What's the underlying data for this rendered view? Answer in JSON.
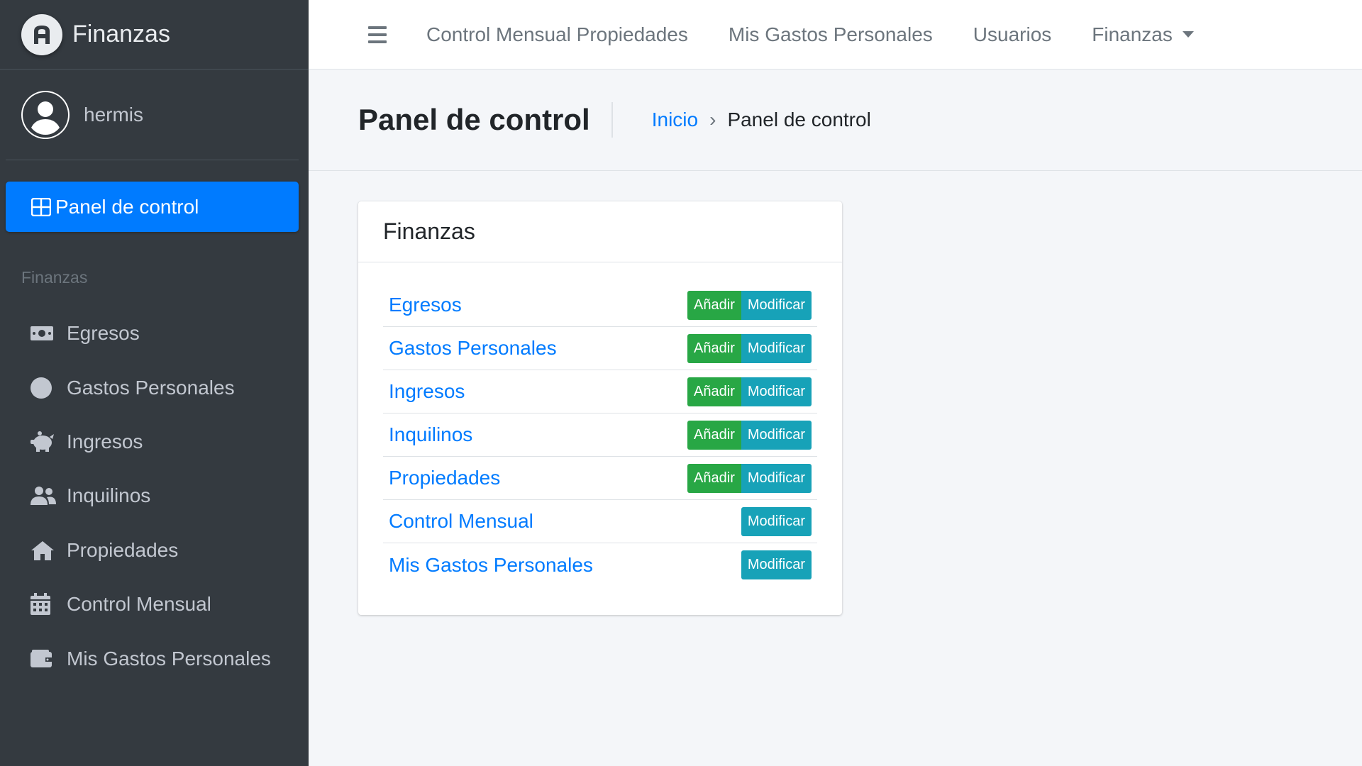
{
  "brand": {
    "name": "Finanzas"
  },
  "user": {
    "name": "hermis"
  },
  "sidebar": {
    "active": {
      "label": "Panel de control",
      "icon": "dashboard-icon"
    },
    "section_header": "Finanzas",
    "items": [
      {
        "label": "Egresos",
        "icon": "money-bill-icon"
      },
      {
        "label": "Gastos Personales",
        "icon": "circle-icon"
      },
      {
        "label": "Ingresos",
        "icon": "piggy-bank-icon"
      },
      {
        "label": "Inquilinos",
        "icon": "users-icon"
      },
      {
        "label": "Propiedades",
        "icon": "home-icon"
      },
      {
        "label": "Control Mensual",
        "icon": "calendar-icon"
      },
      {
        "label": "Mis Gastos Personales",
        "icon": "wallet-icon"
      }
    ]
  },
  "topnav": {
    "links": [
      "Control Mensual Propiedades",
      "Mis Gastos Personales",
      "Usuarios"
    ],
    "dropdown": "Finanzas"
  },
  "header": {
    "title": "Panel de control",
    "breadcrumb": {
      "home": "Inicio",
      "separator": "›",
      "current": "Panel de control"
    }
  },
  "card": {
    "title": "Finanzas",
    "add_label": "Añadir",
    "modify_label": "Modificar",
    "rows": [
      {
        "label": "Egresos"
      },
      {
        "label": "Gastos Personales"
      },
      {
        "label": "Ingresos"
      },
      {
        "label": "Inquilinos"
      },
      {
        "label": "Propiedades"
      },
      {
        "label": "Control Mensual"
      },
      {
        "label": "Mis Gastos Personales"
      }
    ]
  },
  "colors": {
    "primary": "#007bff",
    "success": "#28a745",
    "info": "#17a2b8",
    "sidebar": "#343a40"
  }
}
